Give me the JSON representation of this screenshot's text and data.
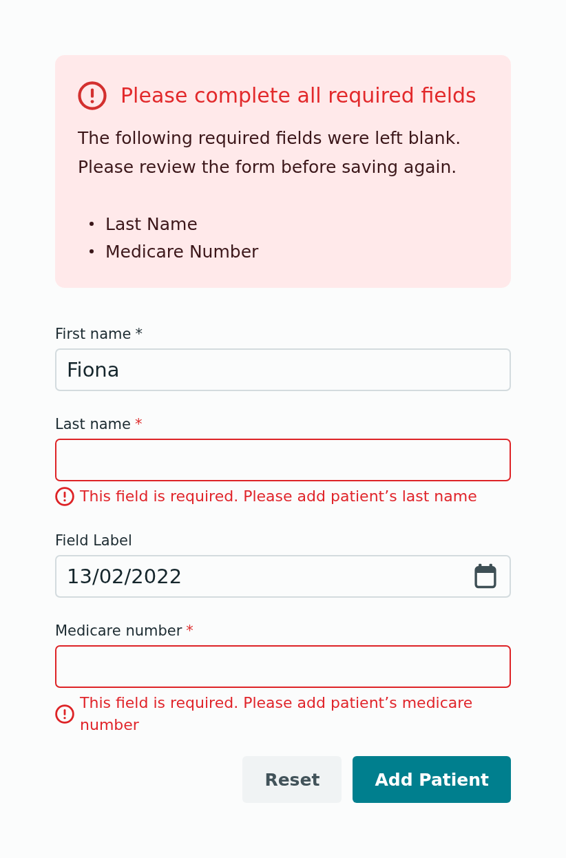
{
  "alert": {
    "title": "Please complete all required fields",
    "message": "The following required fields were left blank. Please review the form before saving again.",
    "items": [
      "Last Name",
      "Medicare Number"
    ]
  },
  "fields": [
    {
      "kind": "text",
      "label": "First name",
      "required_mark": "*",
      "value": "Fiona",
      "invalid": false
    },
    {
      "kind": "text",
      "label": "Last name",
      "required_mark": "*",
      "invalid": true,
      "error": "This field is required. Please add patient’s last name"
    },
    {
      "kind": "date",
      "label": "Field Label",
      "value": "13/02/2022",
      "invalid": false
    },
    {
      "kind": "text",
      "label": "Medicare number",
      "required_mark": "*",
      "invalid": true,
      "error": "This field is required. Please add patient’s medicare number"
    }
  ],
  "buttons": [
    {
      "label": "Reset",
      "kind": "secondary"
    },
    {
      "label": "Add Patient",
      "kind": "primary"
    }
  ]
}
